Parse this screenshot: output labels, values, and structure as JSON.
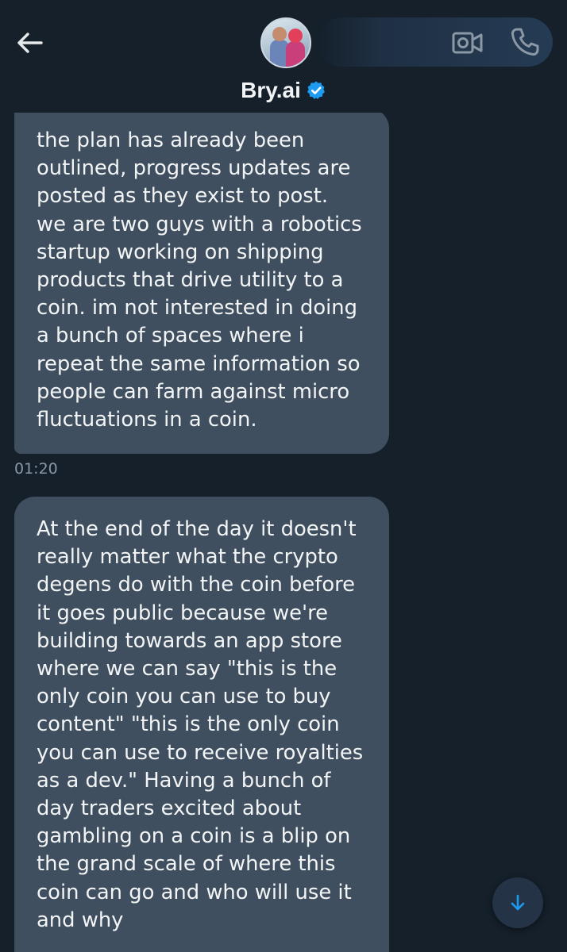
{
  "header": {
    "name": "Bry.ai",
    "verified": true,
    "icons": {
      "back": "arrow-left-icon",
      "video": "video-camera-icon",
      "call": "phone-icon",
      "verified": "verified-badge-icon"
    }
  },
  "messages": [
    {
      "text": "the plan has already been\noutlined, progress updates are\nposted as they exist to post.\nwe are two guys with a robotics\nstartup working on shipping\nproducts that drive utility to a\ncoin.  im not interested in doing\na bunch of spaces where i\nrepeat the same information so\npeople can farm against micro\nfluctuations in a coin.",
      "time": "01:20"
    },
    {
      "text": "At the end of the day it doesn't\nreally matter what the crypto\ndegens do with the coin before\nit goes public because we're\nbuilding towards an app store\nwhere we can say \"this is the\nonly coin you can use to buy\ncontent\" \"this is the only coin\nyou can use to receive royalties\nas a dev.\"  Having a bunch of\nday traders excited about\ngambling on a coin is a blip on\nthe grand scale of where this\ncoin can go and who will use it\nand why"
    }
  ],
  "scroll_button": {
    "icon": "arrow-down-icon"
  },
  "colors": {
    "background": "#15202b",
    "bubble": "#3f4f5f",
    "accent": "#1d9bf0",
    "timestamp": "#8899a6"
  }
}
